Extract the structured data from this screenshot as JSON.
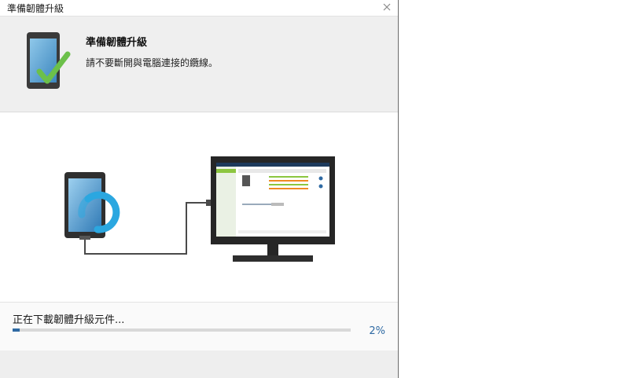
{
  "window": {
    "title": "準備韌體升級"
  },
  "header": {
    "title": "準備韌體升級",
    "subtitle": "請不要斷開與電腦連接的纜線。"
  },
  "status": {
    "label": "正在下載韌體升級元件...",
    "progress_percent": 2,
    "progress_text": "2%"
  },
  "colors": {
    "accent": "#2f6aa3",
    "check": "#6cc04a",
    "sync_ring": "#2ba7e0"
  },
  "icons": {
    "close": "close-icon",
    "device_check": "device-check-icon",
    "sync": "sync-icon"
  }
}
